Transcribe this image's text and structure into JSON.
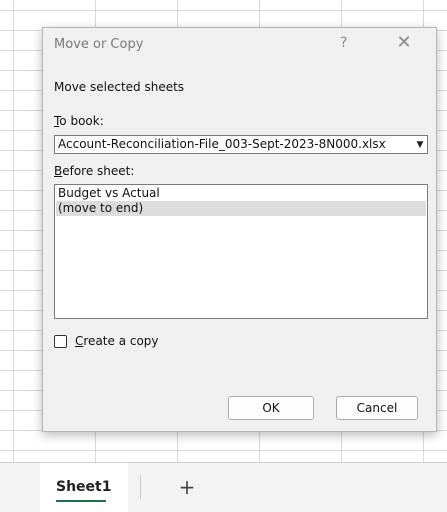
{
  "dialog": {
    "title": "Move or Copy",
    "help": "?",
    "close": "✕",
    "heading": "Move selected sheets",
    "to_book_label_mn": "T",
    "to_book_label_rest": "o book:",
    "to_book_value": "Account-Reconciliation-File_003-Sept-2023-8N000.xlsx",
    "before_sheet_label_mn": "B",
    "before_sheet_label_rest": "efore sheet:",
    "sheets": [
      "Budget vs Actual",
      "(move to end)"
    ],
    "create_copy_mn": "C",
    "create_copy_rest": "reate a copy",
    "ok_label": "OK",
    "cancel_label": "Cancel"
  },
  "sheetbar": {
    "active_tab": "Sheet1",
    "add_label": "+"
  }
}
